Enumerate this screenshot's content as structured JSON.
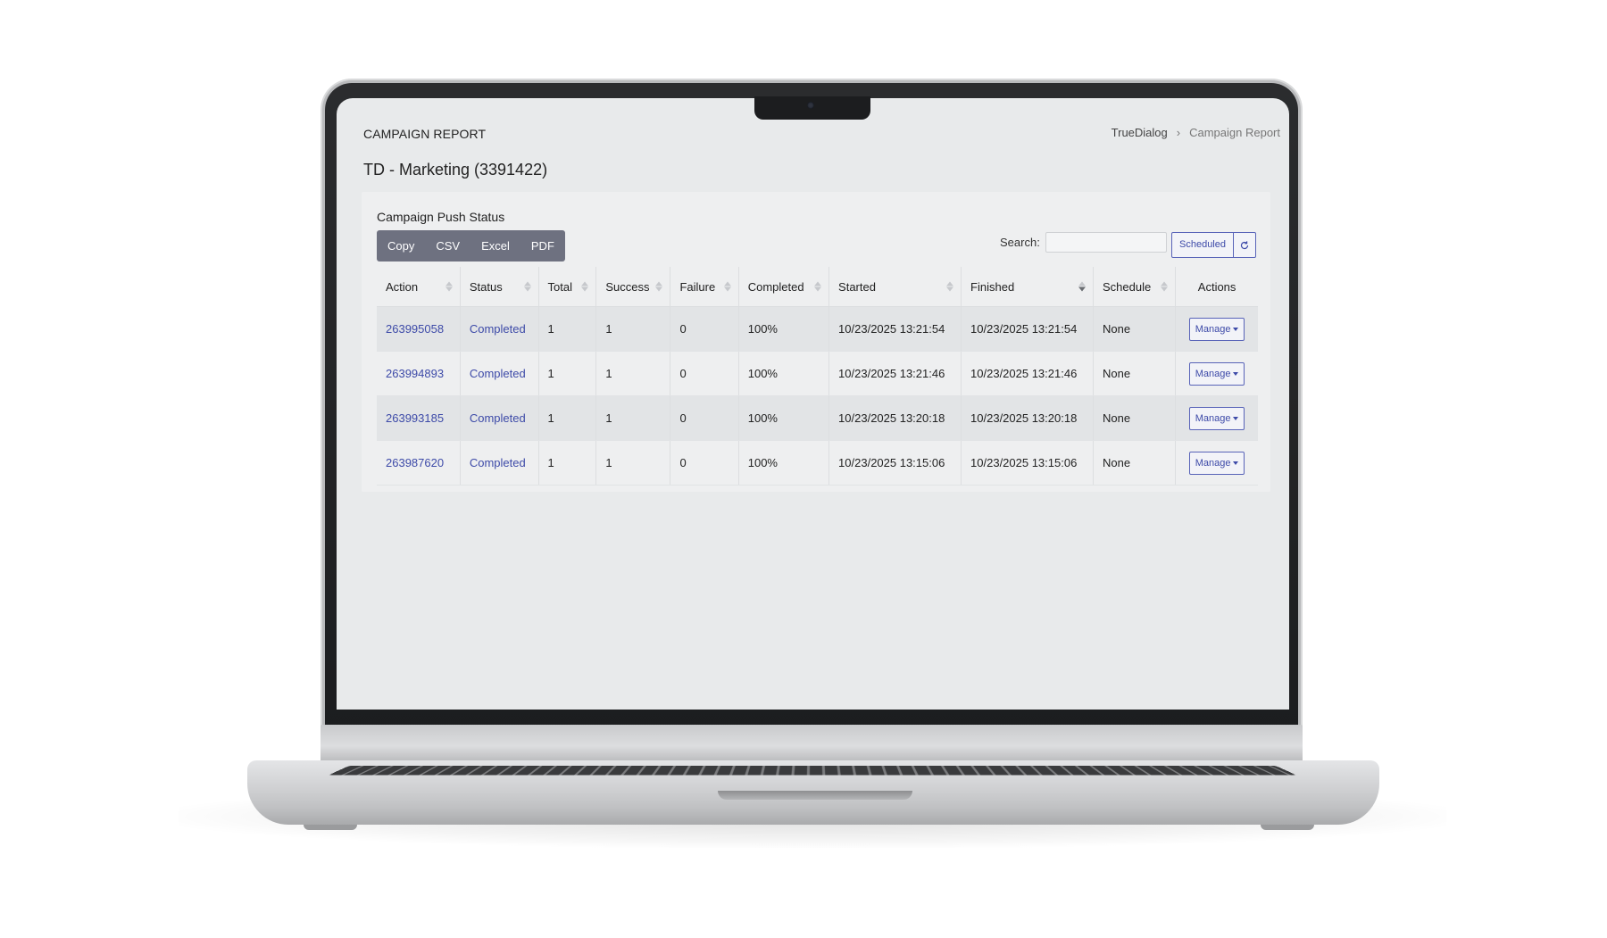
{
  "header": {
    "page_heading": "CAMPAIGN REPORT",
    "campaign_title": "TD - Marketing (3391422)"
  },
  "breadcrumb": {
    "root": "TrueDialog",
    "separator": "›",
    "current": "Campaign Report"
  },
  "panel": {
    "title": "Campaign Push Status",
    "export_buttons": [
      "Copy",
      "CSV",
      "Excel",
      "PDF"
    ],
    "search_label": "Search:",
    "search_value": "",
    "scheduled_label": "Scheduled",
    "refresh_icon": "refresh-icon"
  },
  "table": {
    "columns": [
      "Action",
      "Status",
      "Total",
      "Success",
      "Failure",
      "Completed",
      "Started",
      "Finished",
      "Schedule",
      "Actions"
    ],
    "sorted_column": "Finished",
    "rows": [
      {
        "action": "263995058",
        "status": "Completed",
        "total": "1",
        "success": "1",
        "failure": "0",
        "completed": "100%",
        "started": "10/23/2025 13:21:54",
        "finished": "10/23/2025 13:21:54",
        "schedule": "None",
        "manage": "Manage"
      },
      {
        "action": "263994893",
        "status": "Completed",
        "total": "1",
        "success": "1",
        "failure": "0",
        "completed": "100%",
        "started": "10/23/2025 13:21:46",
        "finished": "10/23/2025 13:21:46",
        "schedule": "None",
        "manage": "Manage"
      },
      {
        "action": "263993185",
        "status": "Completed",
        "total": "1",
        "success": "1",
        "failure": "0",
        "completed": "100%",
        "started": "10/23/2025 13:20:18",
        "finished": "10/23/2025 13:20:18",
        "schedule": "None",
        "manage": "Manage"
      },
      {
        "action": "263987620",
        "status": "Completed",
        "total": "1",
        "success": "1",
        "failure": "0",
        "completed": "100%",
        "started": "10/23/2025 13:15:06",
        "finished": "10/23/2025 13:15:06",
        "schedule": "None",
        "manage": "Manage"
      }
    ]
  },
  "colors": {
    "link": "#3d4aa8",
    "button_group": "#6e7180",
    "screen_bg": "#e8eaeb"
  }
}
